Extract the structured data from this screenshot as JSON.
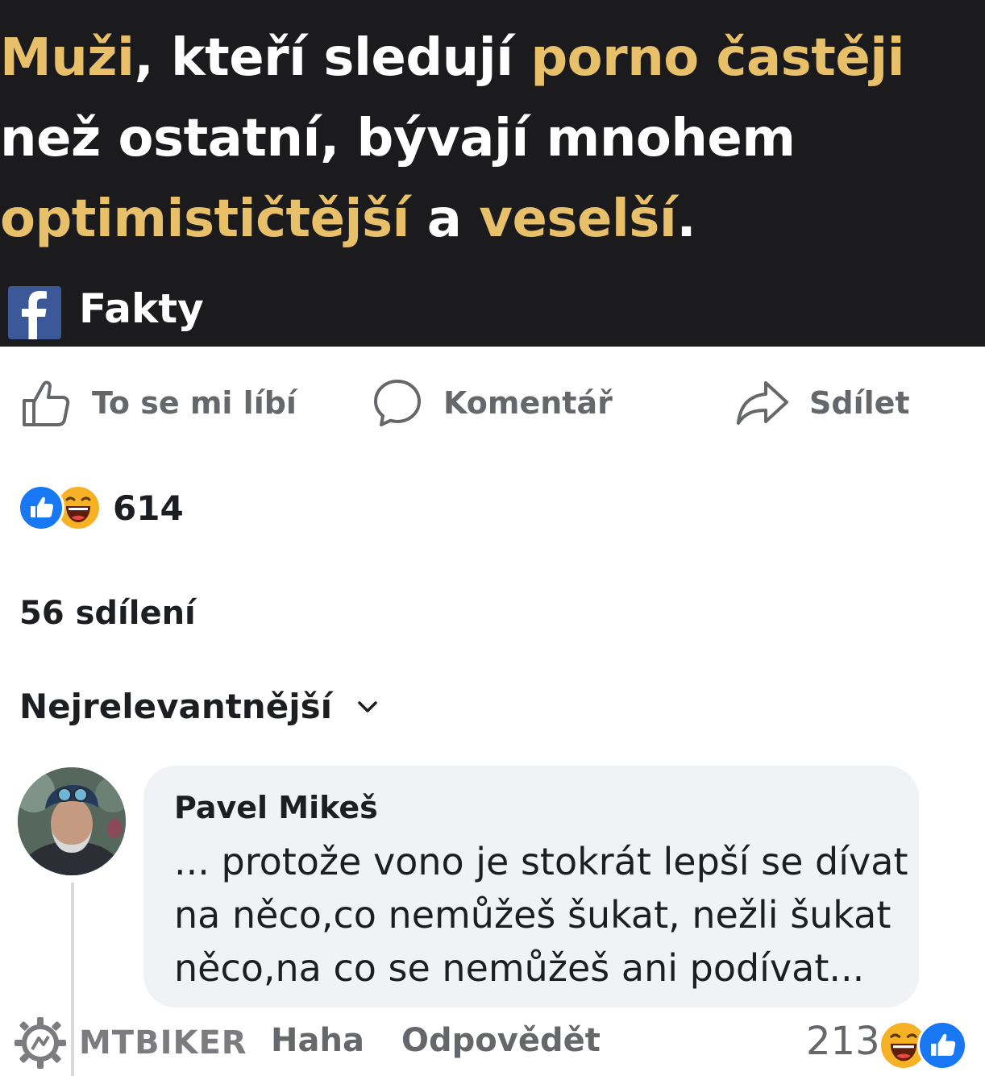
{
  "post": {
    "headline_lines": [
      [
        {
          "text": "Muži",
          "hl": true
        },
        {
          "text": ", kteří sledují ",
          "hl": false
        },
        {
          "text": "porno častěji",
          "hl": true
        }
      ],
      [
        {
          "text": "než ostatní, bývají mnohem",
          "hl": false
        }
      ],
      [
        {
          "text": "optimističtější",
          "hl": true
        },
        {
          "text": " a ",
          "hl": false
        },
        {
          "text": "veselší",
          "hl": true
        },
        {
          "text": ".",
          "hl": false
        }
      ]
    ],
    "source_name": "Fakty",
    "source_icon": "facebook-icon"
  },
  "actions": {
    "like_label": "To se mi líbí",
    "comment_label": "Komentář",
    "share_label": "Sdílet"
  },
  "stats": {
    "reaction_count": "614",
    "shares_text": "56 sdílení"
  },
  "comments": {
    "sort_label": "Nejrelevantnější",
    "items": [
      {
        "author": "Pavel Mikeš",
        "text_lines": [
          "... protože vono je stokrát lepší se dívat",
          "na něco,co nemůžeš šukat, nežli šukat",
          "něco,na co se nemůžeš ani podívat..."
        ],
        "haha_label": "Haha",
        "reply_label": "Odpovědět",
        "reaction_count": "213"
      }
    ]
  },
  "watermark": {
    "text": "MTBIKER"
  },
  "colors": {
    "banner_bg": "#1b1b1d",
    "highlight": "#e8c06a",
    "facebook_blue": "#3b5998",
    "like_blue": "#1877f2",
    "haha_yellow": "#f7b125",
    "muted_text": "#65676b",
    "bubble_bg": "#f0f2f5"
  }
}
